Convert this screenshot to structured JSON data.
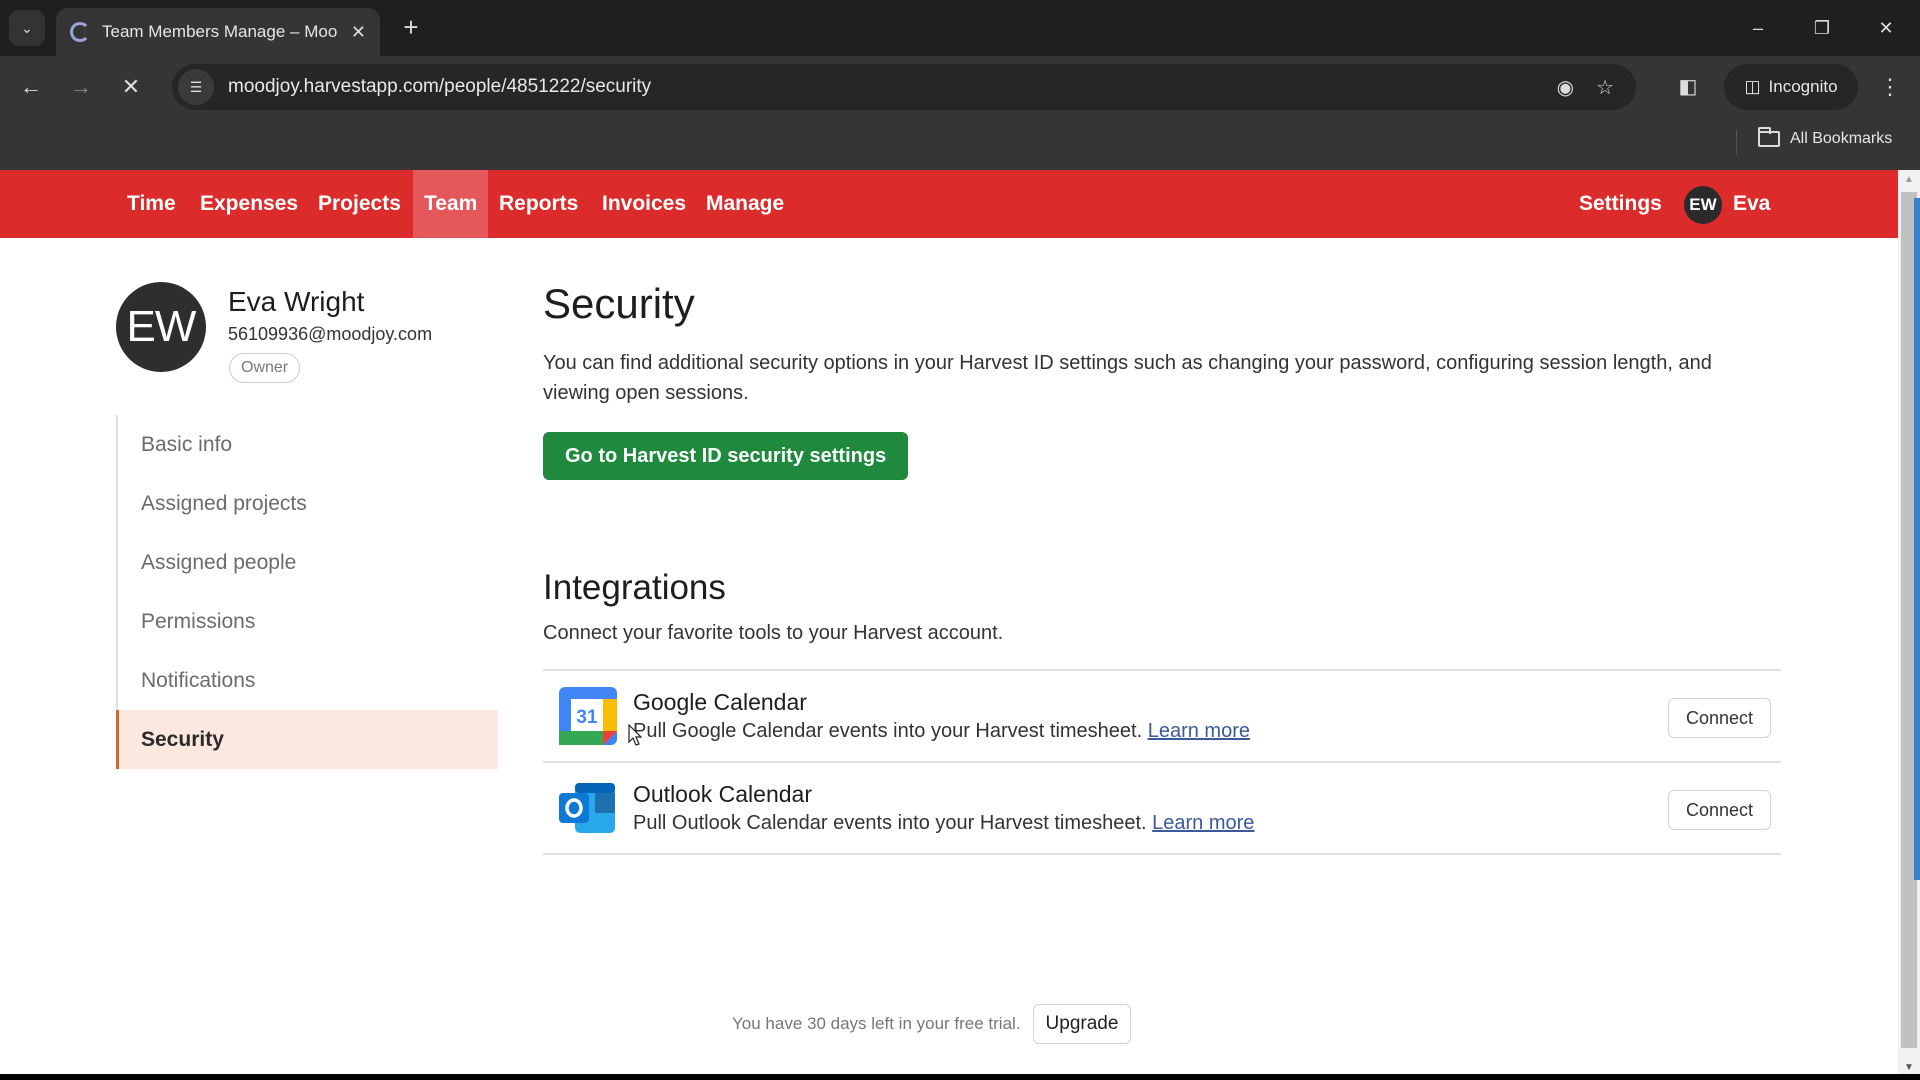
{
  "browser": {
    "tab_title": "Team Members Manage – Moo",
    "url": "moodjoy.harvestapp.com/people/4851222/security",
    "incognito_label": "Incognito",
    "all_bookmarks_label": "All Bookmarks",
    "icons": {
      "tab_search": "chevron-down-icon",
      "new_tab": "plus-icon",
      "minimize": "minimize-icon",
      "restore": "restore-icon",
      "close_window": "close-icon",
      "back": "back-arrow-icon",
      "forward": "forward-arrow-icon",
      "stop": "stop-loading-icon",
      "site_info": "tune-icon",
      "tracking_off": "eye-off-icon",
      "bookmark_star": "star-icon",
      "side_panel": "side-panel-icon",
      "incognito": "incognito-icon",
      "menu": "kebab-menu-icon",
      "folder": "folder-icon"
    }
  },
  "app_nav": {
    "items": [
      {
        "label": "Time",
        "active": false
      },
      {
        "label": "Expenses",
        "active": false
      },
      {
        "label": "Projects",
        "active": false
      },
      {
        "label": "Team",
        "active": true
      },
      {
        "label": "Reports",
        "active": false
      },
      {
        "label": "Invoices",
        "active": false
      },
      {
        "label": "Manage",
        "active": false
      }
    ],
    "settings_label": "Settings",
    "user_initials": "EW",
    "user_first_name": "Eva",
    "brand_color": "#db2b2b"
  },
  "profile": {
    "initials": "EW",
    "name": "Eva Wright",
    "email": "56109936@moodjoy.com",
    "role_badge": "Owner"
  },
  "side_menu": {
    "items": [
      {
        "label": "Basic info",
        "active": false
      },
      {
        "label": "Assigned projects",
        "active": false
      },
      {
        "label": "Assigned people",
        "active": false
      },
      {
        "label": "Permissions",
        "active": false
      },
      {
        "label": "Notifications",
        "active": false
      },
      {
        "label": "Security",
        "active": true
      }
    ]
  },
  "security": {
    "title": "Security",
    "description": "You can find additional security options in your Harvest ID settings such as changing your password, configuring session length, and viewing open sessions.",
    "button_label": "Go to Harvest ID security settings",
    "button_color": "#1f8a3d"
  },
  "integrations": {
    "title": "Integrations",
    "description": "Connect your favorite tools to your Harvest account.",
    "items": [
      {
        "icon": "google-calendar-icon",
        "name": "Google Calendar",
        "description": "Pull Google Calendar events into your Harvest timesheet.",
        "link_label": "Learn more",
        "button_label": "Connect"
      },
      {
        "icon": "outlook-calendar-icon",
        "name": "Outlook Calendar",
        "description": "Pull Outlook Calendar events into your Harvest timesheet.",
        "link_label": "Learn more",
        "button_label": "Connect"
      }
    ],
    "google_calendar_day": "31"
  },
  "trial": {
    "text": "You have 30 days left in your free trial.",
    "upgrade_label": "Upgrade"
  }
}
